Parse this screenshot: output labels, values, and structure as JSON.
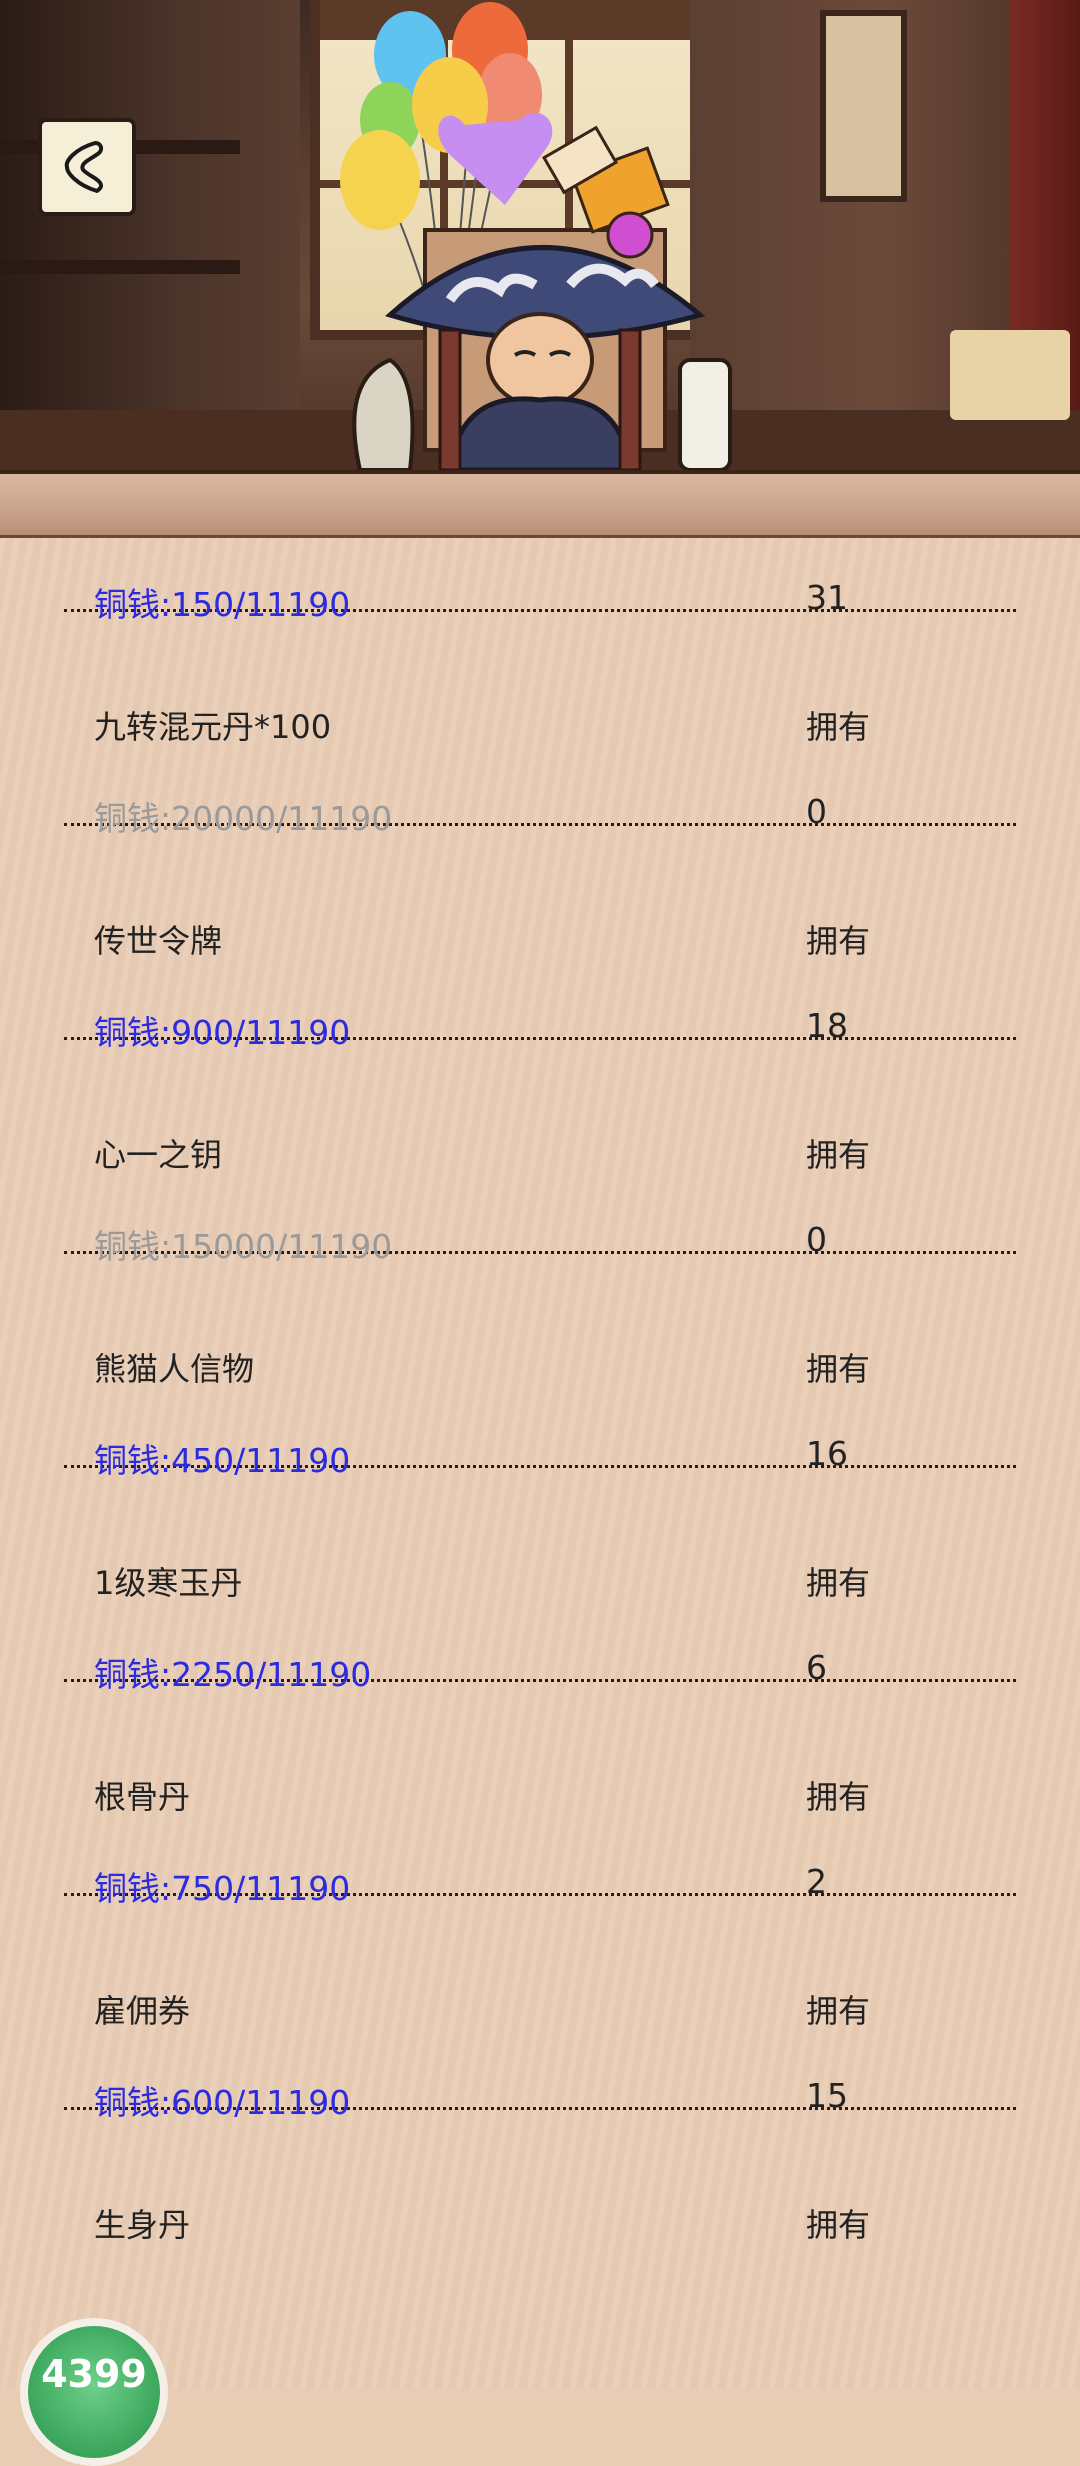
{
  "header": {
    "back_icon": "back-chevron-icon"
  },
  "labels": {
    "own": "拥有"
  },
  "items": [
    {
      "name": "",
      "price": "铜钱:150/11190",
      "count": "31",
      "affordable": true
    },
    {
      "name": "九转混元丹*100",
      "price": "铜钱:20000/11190",
      "count": "0",
      "affordable": false
    },
    {
      "name": "传世令牌",
      "price": "铜钱:900/11190",
      "count": "18",
      "affordable": true
    },
    {
      "name": "心一之钥",
      "price": "铜钱:15000/11190",
      "count": "0",
      "affordable": false
    },
    {
      "name": "熊猫人信物",
      "price": "铜钱:450/11190",
      "count": "16",
      "affordable": true
    },
    {
      "name": "1级寒玉丹",
      "price": "铜钱:2250/11190",
      "count": "6",
      "affordable": true
    },
    {
      "name": "根骨丹",
      "price": "铜钱:750/11190",
      "count": "2",
      "affordable": true
    },
    {
      "name": "雇佣券",
      "price": "铜钱:600/11190",
      "count": "15",
      "affordable": true
    },
    {
      "name": "生身丹",
      "price": "",
      "count": "",
      "affordable": true
    }
  ],
  "badge": {
    "text": "4399"
  },
  "colors": {
    "affordable": "#2b2be0",
    "unaffordable": "#9a9a9a",
    "background": "#eacdb5"
  }
}
